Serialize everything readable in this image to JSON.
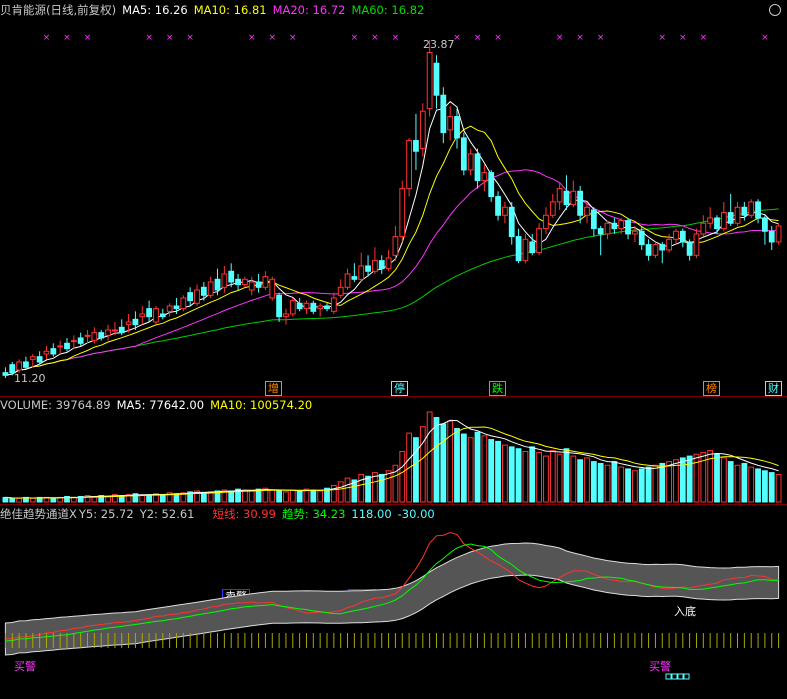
{
  "main_header": {
    "stock_label": "贝肯能源(日线,前复权)",
    "ma5": "MA5: 16.26",
    "ma10": "MA10: 16.81",
    "ma20": "MA20: 16.72",
    "ma60": "MA60: 16.82"
  },
  "price_labels": {
    "high": "23.87",
    "low": "11.20"
  },
  "event_tags": [
    "增",
    "停",
    "跌",
    "榜",
    "财"
  ],
  "volume_header": {
    "volume": "VOLUME: 39764.89",
    "ma5": "MA5: 77642.00",
    "ma10": "MA10: 100574.20"
  },
  "indicator_header": {
    "name": "绝佳趋势通道X",
    "y5": "Y5: 25.72",
    "y2": "Y2: 52.61",
    "short": "短线: 30.99",
    "trend": "趋势: 34.23",
    "v1": "118.00",
    "v2": "-30.00"
  },
  "indicator_labels": {
    "sell1": "卖警",
    "sell2": "卖警",
    "sell3": "卖警",
    "bottom": "入底",
    "buy1": "买警",
    "buy2": "买警"
  },
  "colors": {
    "bg": "#000000",
    "up": "#ff3333",
    "down": "#54ffff",
    "ma5": "#ffffff",
    "ma10": "#ffff00",
    "ma20": "#ff33ff",
    "ma60": "#00cc00",
    "frame": "#7a0000",
    "label": "#c8c8c8"
  },
  "chart_data": {
    "type": "candlestick",
    "ylim": [
      11.2,
      23.87
    ],
    "candles": [
      [
        11.4,
        11.3,
        11.2,
        11.6
      ],
      [
        11.7,
        11.4,
        11.3,
        11.8
      ],
      [
        11.5,
        11.8,
        11.4,
        11.9
      ],
      [
        11.8,
        11.6,
        11.5,
        12.0
      ],
      [
        11.9,
        12.0,
        11.6,
        12.1
      ],
      [
        12.0,
        11.8,
        11.7,
        12.2
      ],
      [
        12.1,
        12.2,
        11.9,
        12.4
      ],
      [
        12.3,
        12.1,
        12.0,
        12.5
      ],
      [
        12.4,
        12.4,
        12.1,
        12.6
      ],
      [
        12.5,
        12.3,
        12.2,
        12.7
      ],
      [
        12.6,
        12.6,
        12.3,
        12.8
      ],
      [
        12.7,
        12.5,
        12.4,
        12.9
      ],
      [
        12.8,
        12.8,
        12.5,
        13.0
      ],
      [
        12.6,
        12.9,
        12.5,
        13.1
      ],
      [
        12.9,
        12.7,
        12.6,
        13.0
      ],
      [
        12.8,
        13.0,
        12.6,
        13.2
      ],
      [
        13.0,
        13.0,
        12.8,
        13.3
      ],
      [
        13.1,
        12.9,
        12.8,
        13.4
      ],
      [
        13.2,
        13.3,
        12.9,
        13.6
      ],
      [
        13.4,
        13.2,
        13.0,
        13.7
      ],
      [
        13.5,
        13.6,
        13.2,
        13.9
      ],
      [
        13.8,
        13.5,
        13.3,
        14.1
      ],
      [
        13.3,
        13.8,
        13.2,
        13.9
      ],
      [
        13.6,
        13.5,
        13.4,
        13.8
      ],
      [
        13.7,
        13.9,
        13.5,
        14.0
      ],
      [
        13.9,
        13.8,
        13.6,
        14.2
      ],
      [
        13.8,
        14.2,
        13.7,
        14.3
      ],
      [
        14.4,
        14.1,
        13.9,
        14.6
      ],
      [
        14.0,
        14.5,
        13.9,
        14.7
      ],
      [
        14.6,
        14.3,
        14.1,
        14.8
      ],
      [
        14.3,
        14.8,
        14.2,
        15.0
      ],
      [
        14.9,
        14.5,
        14.3,
        15.3
      ],
      [
        14.6,
        15.1,
        14.4,
        15.4
      ],
      [
        15.2,
        14.8,
        14.6,
        15.5
      ],
      [
        14.9,
        14.7,
        14.5,
        15.1
      ],
      [
        14.7,
        14.9,
        14.6,
        15.0
      ],
      [
        14.5,
        14.8,
        14.3,
        15.0
      ],
      [
        14.8,
        14.6,
        14.4,
        15.1
      ],
      [
        14.6,
        15.0,
        14.5,
        15.2
      ],
      [
        14.2,
        14.9,
        14.1,
        15.0
      ],
      [
        14.3,
        13.5,
        13.3,
        14.4
      ],
      [
        13.5,
        13.6,
        13.2,
        13.8
      ],
      [
        13.6,
        14.1,
        13.5,
        14.2
      ],
      [
        14.0,
        13.8,
        13.7,
        14.2
      ],
      [
        13.8,
        14.0,
        13.6,
        14.1
      ],
      [
        14.0,
        13.7,
        13.6,
        14.1
      ],
      [
        13.8,
        13.9,
        13.5,
        14.0
      ],
      [
        13.9,
        13.8,
        13.7,
        14.0
      ],
      [
        13.7,
        14.2,
        13.6,
        14.4
      ],
      [
        14.3,
        14.6,
        14.2,
        14.9
      ],
      [
        14.6,
        15.1,
        14.5,
        15.3
      ],
      [
        15.0,
        14.9,
        14.8,
        15.5
      ],
      [
        14.9,
        15.4,
        14.8,
        15.9
      ],
      [
        15.4,
        15.2,
        15.0,
        15.8
      ],
      [
        15.2,
        15.6,
        15.1,
        16.1
      ],
      [
        15.6,
        15.3,
        15.1,
        15.8
      ],
      [
        15.3,
        15.7,
        15.2,
        16.0
      ],
      [
        15.8,
        16.5,
        15.6,
        16.9
      ],
      [
        16.5,
        18.3,
        16.3,
        18.6
      ],
      [
        18.3,
        20.1,
        18.0,
        20.2
      ],
      [
        20.1,
        19.7,
        19.0,
        21.1
      ],
      [
        19.8,
        21.2,
        19.5,
        21.5
      ],
      [
        21.3,
        23.4,
        21.0,
        23.87
      ],
      [
        23.0,
        21.8,
        21.3,
        23.3
      ],
      [
        21.8,
        20.4,
        20.0,
        22.1
      ],
      [
        20.5,
        21.0,
        20.1,
        21.4
      ],
      [
        21.0,
        20.2,
        19.8,
        21.3
      ],
      [
        20.2,
        19.0,
        18.8,
        20.4
      ],
      [
        19.0,
        19.6,
        18.8,
        19.8
      ],
      [
        19.6,
        18.6,
        18.3,
        19.8
      ],
      [
        18.6,
        18.9,
        18.2,
        19.2
      ],
      [
        18.9,
        18.0,
        17.8,
        19.0
      ],
      [
        18.0,
        17.3,
        17.1,
        18.2
      ],
      [
        17.3,
        17.6,
        17.0,
        17.8
      ],
      [
        17.6,
        16.5,
        16.2,
        17.8
      ],
      [
        16.5,
        15.6,
        15.5,
        16.8
      ],
      [
        15.6,
        16.4,
        15.5,
        16.6
      ],
      [
        16.3,
        15.9,
        15.8,
        16.6
      ],
      [
        15.9,
        16.8,
        15.8,
        17.0
      ],
      [
        16.8,
        17.3,
        16.6,
        17.6
      ],
      [
        17.3,
        17.8,
        17.2,
        18.1
      ],
      [
        17.8,
        18.3,
        17.5,
        18.5
      ],
      [
        18.2,
        17.7,
        17.5,
        18.8
      ],
      [
        17.7,
        18.2,
        17.6,
        18.6
      ],
      [
        18.2,
        17.3,
        17.0,
        18.4
      ],
      [
        17.3,
        17.6,
        17.0,
        17.8
      ],
      [
        17.5,
        16.8,
        16.5,
        17.6
      ],
      [
        16.8,
        16.6,
        15.8,
        16.9
      ],
      [
        16.6,
        17.0,
        16.4,
        17.1
      ],
      [
        17.0,
        16.8,
        16.6,
        17.2
      ],
      [
        16.8,
        17.1,
        16.6,
        17.2
      ],
      [
        17.1,
        16.6,
        16.4,
        17.2
      ],
      [
        16.6,
        16.7,
        16.3,
        16.9
      ],
      [
        16.7,
        16.2,
        16.0,
        16.9
      ],
      [
        16.2,
        15.8,
        15.6,
        16.4
      ],
      [
        15.8,
        16.2,
        15.7,
        16.3
      ],
      [
        16.2,
        16.0,
        15.5,
        16.3
      ],
      [
        16.0,
        16.4,
        15.9,
        16.6
      ],
      [
        16.4,
        16.7,
        16.2,
        16.8
      ],
      [
        16.7,
        16.3,
        16.1,
        16.8
      ],
      [
        16.3,
        15.8,
        15.6,
        16.4
      ],
      [
        15.8,
        16.6,
        15.7,
        16.8
      ],
      [
        16.6,
        17.0,
        16.5,
        17.3
      ],
      [
        17.0,
        17.2,
        16.8,
        17.6
      ],
      [
        17.2,
        16.8,
        16.6,
        17.3
      ],
      [
        16.8,
        17.4,
        16.7,
        17.8
      ],
      [
        17.4,
        17.0,
        16.9,
        18.1
      ],
      [
        17.0,
        17.6,
        16.9,
        17.8
      ],
      [
        17.6,
        17.3,
        17.1,
        17.8
      ],
      [
        17.3,
        17.8,
        17.2,
        17.9
      ],
      [
        17.8,
        17.2,
        17.0,
        17.9
      ],
      [
        17.2,
        16.7,
        16.2,
        17.3
      ],
      [
        16.7,
        16.3,
        16.0,
        16.9
      ],
      [
        16.3,
        16.9,
        16.2,
        17.0
      ]
    ],
    "volumes": [
      5,
      4,
      4,
      5,
      4,
      5,
      5,
      4,
      5,
      6,
      5,
      6,
      7,
      6,
      7,
      6,
      8,
      7,
      8,
      9,
      7,
      8,
      9,
      8,
      10,
      9,
      10,
      11,
      12,
      10,
      11,
      12,
      13,
      12,
      14,
      13,
      12,
      14,
      15,
      13,
      12,
      11,
      13,
      12,
      14,
      13,
      12,
      15,
      18,
      22,
      26,
      24,
      30,
      28,
      32,
      30,
      34,
      40,
      55,
      75,
      70,
      82,
      98,
      92,
      85,
      88,
      80,
      74,
      70,
      76,
      72,
      68,
      66,
      62,
      60,
      58,
      55,
      60,
      54,
      50,
      56,
      52,
      58,
      50,
      46,
      48,
      44,
      42,
      40,
      44,
      38,
      36,
      34,
      36,
      38,
      40,
      42,
      44,
      46,
      48,
      50,
      52,
      54,
      56,
      52,
      48,
      44,
      40,
      42,
      38,
      36,
      34,
      32,
      30
    ]
  }
}
